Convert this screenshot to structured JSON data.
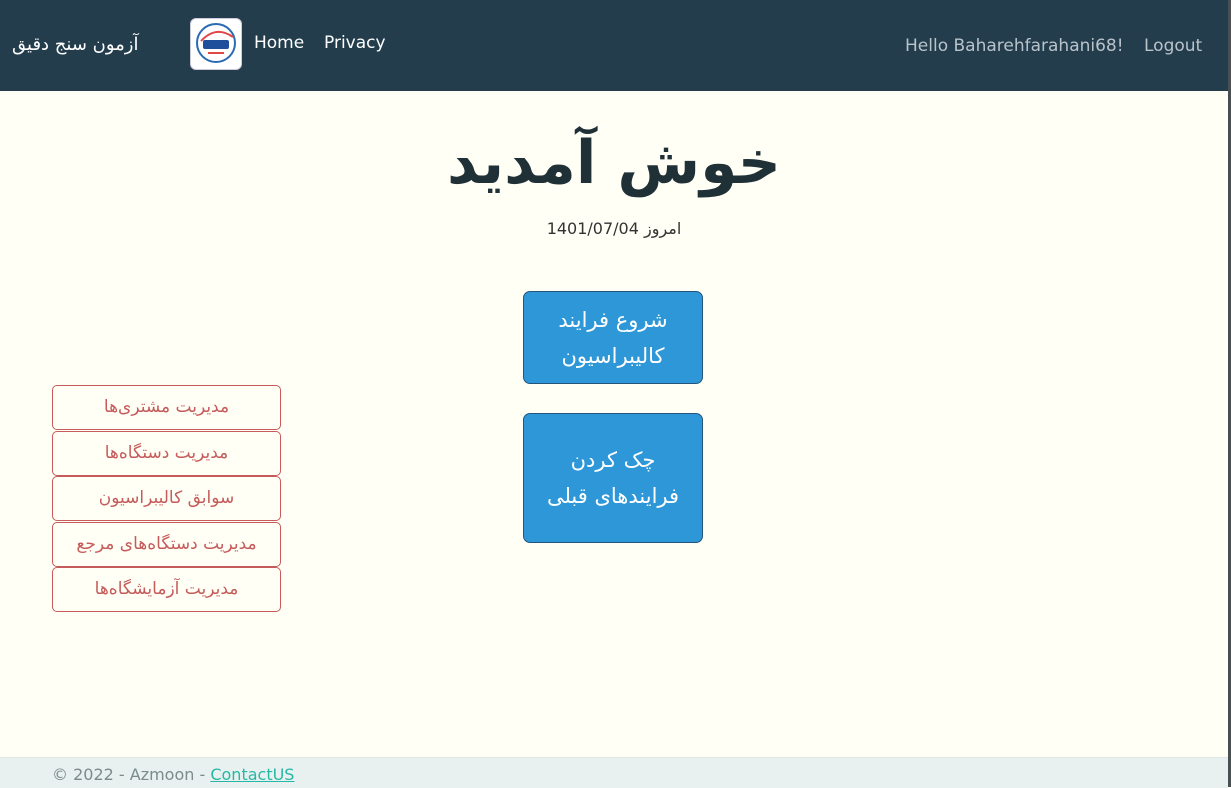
{
  "navbar": {
    "brand": "آزمون سنج دقیق",
    "logo_icon": "azmoon-logo",
    "links": [
      "Home",
      "Privacy"
    ],
    "greeting": "Hello Baharehfarahani68!",
    "logout": "Logout",
    "bg_color": "#233d4d"
  },
  "main": {
    "title": "خوش آمدید",
    "today": "امروز 1401/07/04",
    "actions": [
      "شروع فرایند کالیبراسیون",
      "چک کردن فرایندهای قبلی"
    ],
    "side_menu": [
      "مدیریت مشتری‌ها",
      "مدیریت دستگاه‌ها",
      "سوابق کالیبراسیون",
      "مدیریت دستگاه‌های مرجع",
      "مدیریت آزمایشگاه‌ها"
    ],
    "primary_color": "#2e97d8",
    "side_color": "#c65b5b"
  },
  "footer": {
    "text": "© 2022 - Azmoon - ",
    "link": "ContactUS"
  }
}
